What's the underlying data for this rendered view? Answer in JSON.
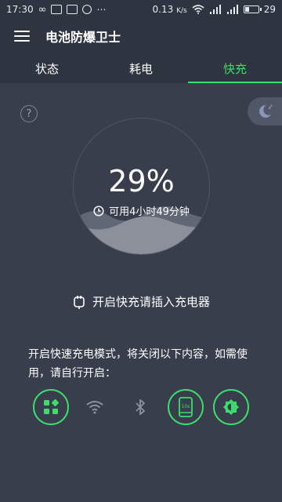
{
  "status_bar": {
    "time": "17:30",
    "speed": "0.13",
    "speed_unit": "K/s",
    "battery_text": "29"
  },
  "app": {
    "title": "电池防爆卫士"
  },
  "tabs": [
    {
      "label": "状态",
      "active": false
    },
    {
      "label": "耗电",
      "active": false
    },
    {
      "label": "快充",
      "active": true
    }
  ],
  "gauge": {
    "percent_text": "29%",
    "level": 0.29,
    "remaining": "可用4小时49分钟"
  },
  "charge_hint": "开启快充请插入充电器",
  "notice": "开启快速充电模式，将关闭以下内容，如需使用，请自行开启：",
  "features": [
    {
      "name": "apps-icon",
      "enabled": true
    },
    {
      "name": "wifi-icon",
      "enabled": false
    },
    {
      "name": "bluetooth-icon",
      "enabled": false
    },
    {
      "name": "screen-timeout-icon",
      "enabled": true
    },
    {
      "name": "brightness-icon",
      "enabled": true
    }
  ],
  "colors": {
    "background": "#383e4b",
    "header": "#2f3540",
    "accent": "#3ddc6b",
    "muted": "#8a92a1"
  }
}
